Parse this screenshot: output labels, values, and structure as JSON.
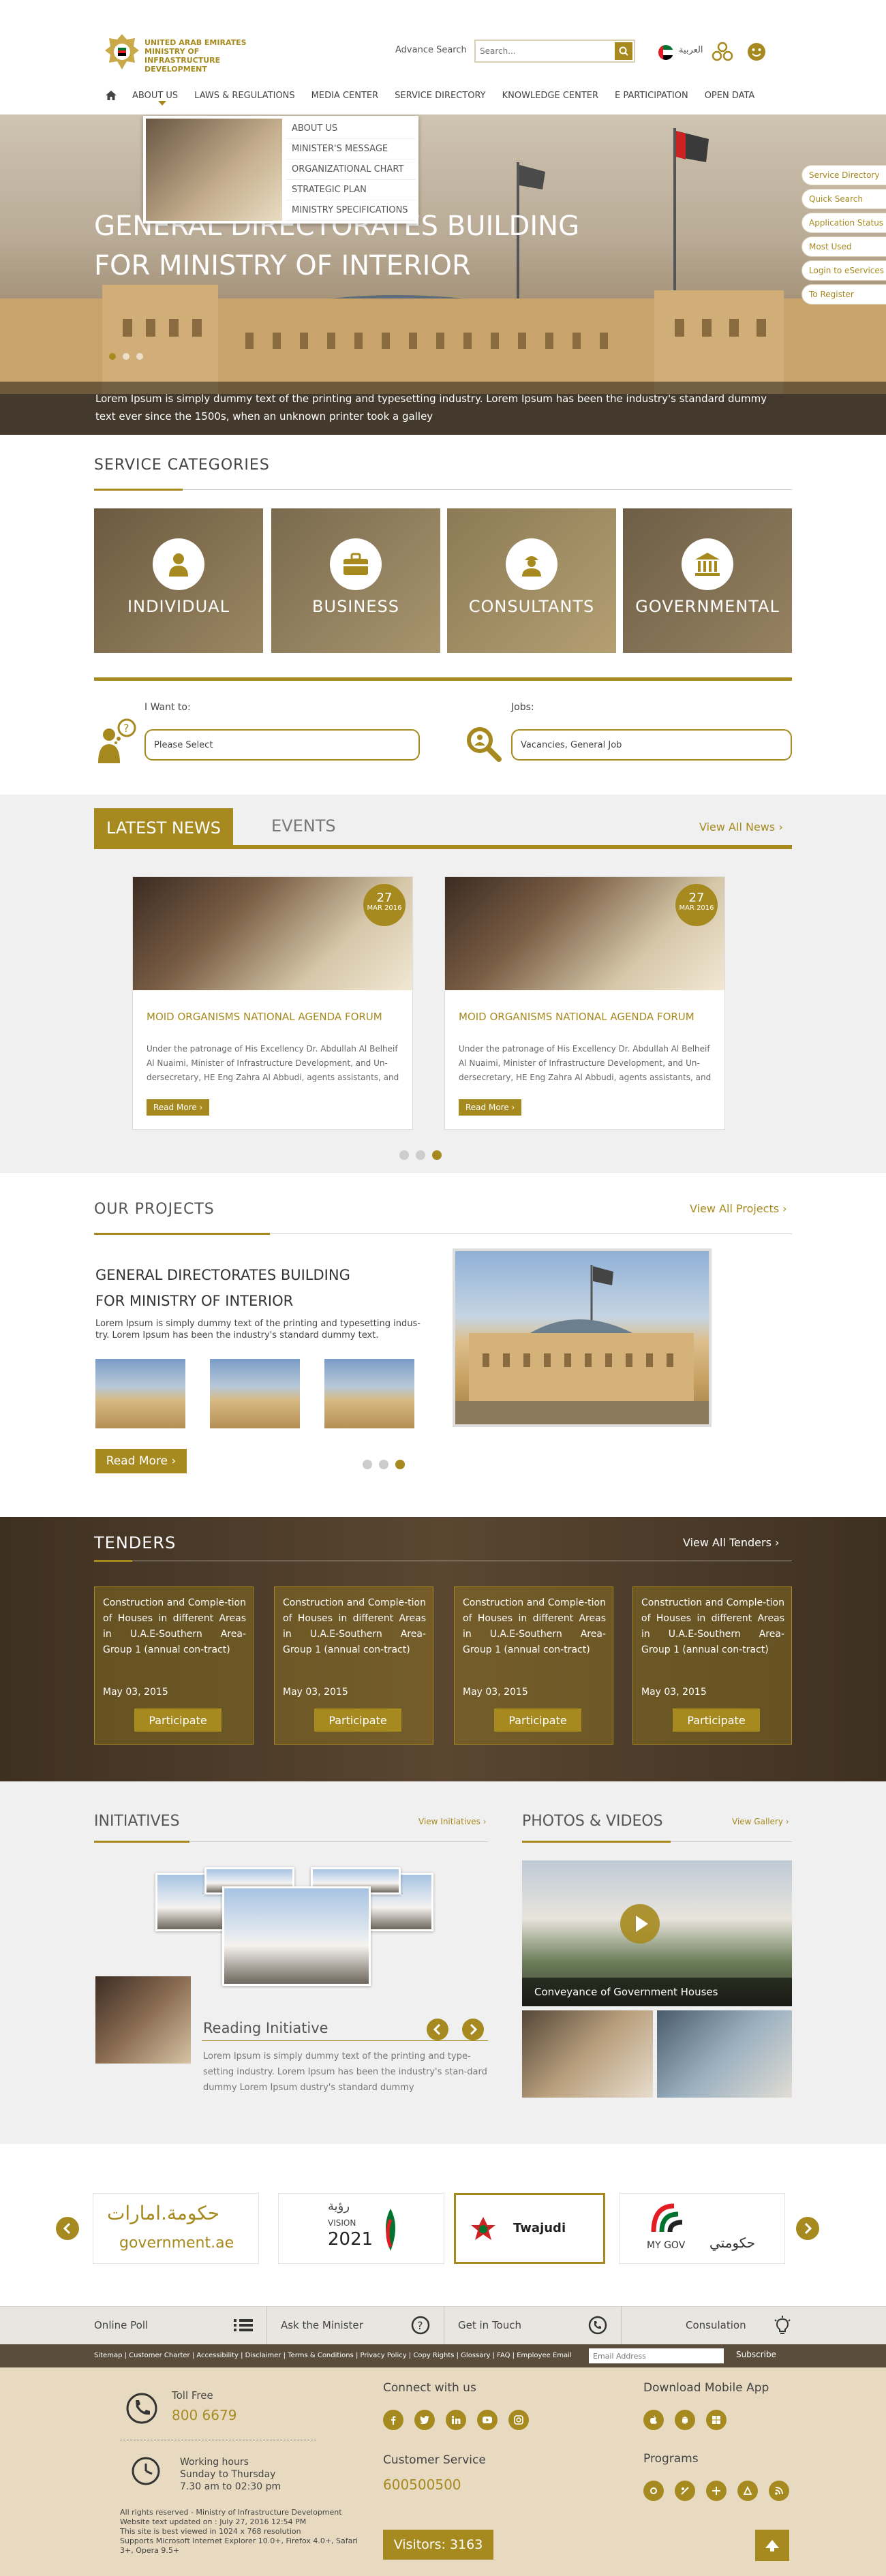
{
  "colors": {
    "accent": "#a68a1f",
    "dark_brown": "#5a4d3c",
    "footer_bg": "#e7dac1"
  },
  "header": {
    "logo_lines": [
      "UNITED ARAB EMIRATES",
      "MINISTRY OF INFRASTRUCTURE",
      "DEVELOPMENT"
    ],
    "advance_search": "Advance Search",
    "search_placeholder": "Search...",
    "lang": "العربية"
  },
  "nav": {
    "items": [
      "ABOUT US",
      "LAWS & REGULATIONS",
      "MEDIA CENTER",
      "SERVICE DIRECTORY",
      "KNOWLEDGE  CENTER",
      "E PARTICIPATION",
      "OPEN DATA"
    ]
  },
  "dropdown": {
    "items": [
      "ABOUT US",
      "MINISTER'S MESSAGE",
      "ORGANIZATIONAL CHART",
      "STRATEGIC PLAN",
      "MINISTRY SPECIFICATIONS"
    ]
  },
  "hero": {
    "title_line1": "GENERAL DIRECTORATES BUILDING",
    "title_line2": "FOR MINISTRY OF INTERIOR",
    "caption": "Lorem Ipsum is simply dummy text of the printing and typesetting industry. Lorem Ipsum has been the industry's standard dummy text ever since the 1500s, when an unknown printer took a galley"
  },
  "quick_links": [
    "Service Directory",
    "Quick Search",
    "Application Status",
    "Most Used",
    "Login to eServices",
    "To Register"
  ],
  "services": {
    "title": "SERVICE CATEGORIES",
    "categories": [
      "INDIVIDUAL",
      "BUSINESS",
      "CONSULTANTS",
      "GOVERNMENTAL"
    ]
  },
  "want": {
    "label": "I Want to:",
    "select_value": "Please Select",
    "jobs_label": "Jobs:",
    "jobs_value": "Vacancies, General Job"
  },
  "news": {
    "tab_active": "LATEST NEWS",
    "tab_events": "EVENTS",
    "view_all": "View All News",
    "items": [
      {
        "day": "27",
        "month": "MAR 2016",
        "title": "MOID ORGANISMS NATIONAL AGENDA FORUM",
        "body": "Under the patronage of His Excellency Dr. Abdullah Al Belheif Al Nuaimi, Minister of Infrastructure Development, and Un-dersecretary, HE Eng Zahra Al Abbudi, agents assistants, and",
        "read_more": "Read More"
      },
      {
        "day": "27",
        "month": "MAR 2016",
        "title": "MOID ORGANISMS NATIONAL AGENDA FORUM",
        "body": "Under the patronage of His Excellency Dr. Abdullah Al Belheif Al Nuaimi, Minister of Infrastructure Development, and Un-dersecretary, HE Eng Zahra Al Abbudi, agents assistants, and",
        "read_more": "Read More"
      }
    ]
  },
  "projects": {
    "title": "OUR PROJECTS",
    "view_all": "View All Projects",
    "heading_line1": "GENERAL DIRECTORATES BUILDING",
    "heading_line2": "FOR MINISTRY OF INTERIOR",
    "description": "Lorem Ipsum is simply dummy text of the printing and typesetting indus-try. Lorem Ipsum has been the industry's standard dummy text.",
    "read_more": "Read More"
  },
  "tenders": {
    "title": "TENDERS",
    "view_all": "View All Tenders",
    "items": [
      {
        "text": "Construction and Comple-tion of Houses in different Areas in U.A.E-Southern Area- Group 1 (annual con-tract)",
        "date": "May 03, 2015",
        "button": "Participate"
      },
      {
        "text": "Construction and Comple-tion of Houses in different Areas in U.A.E-Southern Area- Group 1 (annual con-tract)",
        "date": "May 03, 2015",
        "button": "Participate"
      },
      {
        "text": "Construction and Comple-tion of Houses in different Areas in U.A.E-Southern Area- Group 1 (annual con-tract)",
        "date": "May 03, 2015",
        "button": "Participate"
      },
      {
        "text": "Construction and Comple-tion of Houses in different Areas in U.A.E-Southern Area- Group 1 (annual con-tract)",
        "date": "May 03, 2015",
        "button": "Participate"
      }
    ]
  },
  "initiatives": {
    "title": "INITIATIVES",
    "view_all": "View Initiatives",
    "reading_title": "Reading Initiative",
    "reading_desc": "Lorem Ipsum is simply dummy text of the printing and type-setting industry. Lorem Ipsum has been the industry's stan-dard dummy Lorem Ipsum dustry's standard dummy"
  },
  "photos": {
    "title": "PHOTOS & VIDEOS",
    "view_all": "View Gallery",
    "caption": "Conveyance of Government Houses"
  },
  "partners": {
    "gov_ar": "حكومة.امارات",
    "gov_en": "government.ae",
    "vision_ar": "رؤية",
    "vision_en": "VISION",
    "vision_year": "2021",
    "twajudi": "Twajudi",
    "mygov_en": "MY GOV",
    "mygov_ar": "حكومتي"
  },
  "bottom_bar": {
    "items": [
      "Online Poll",
      "Ask the Minister",
      "Get in Touch",
      "Consulation"
    ]
  },
  "footer_links": {
    "text": "Sitemap | Customer Charter | Accessibility | Disclaimer | Terms & Conditions | Privacy Policy | Copy Rights | Glossary | FAQ | Employee Email",
    "email_placeholder": "Email Address",
    "subscribe": "Subscribe"
  },
  "footer": {
    "toll_free_label": "Toll Free",
    "toll_free_number": "800 6679",
    "hours_label": "Working hours",
    "hours_days": "Sunday to Thursday",
    "hours_time": "7.30 am to 02:30 pm",
    "rights": "All rights reserved - Ministry of Infrastructure Development",
    "updated": "Website text updated on : July 27, 2016 12:54 PM",
    "best_viewed": "This site is best viewed in 1024 x 768 resolution",
    "supports": "Supports Microsoft Internet Explorer 10.0+, Firefox 4.0+, Safari 3+, Opera 9.5+",
    "connect": "Connect with us",
    "customer_service": "Customer Service",
    "customer_service_number": "600500500",
    "visitors": "Visitors: 3163",
    "download_app": "Download Mobile App",
    "programs": "Programs"
  }
}
